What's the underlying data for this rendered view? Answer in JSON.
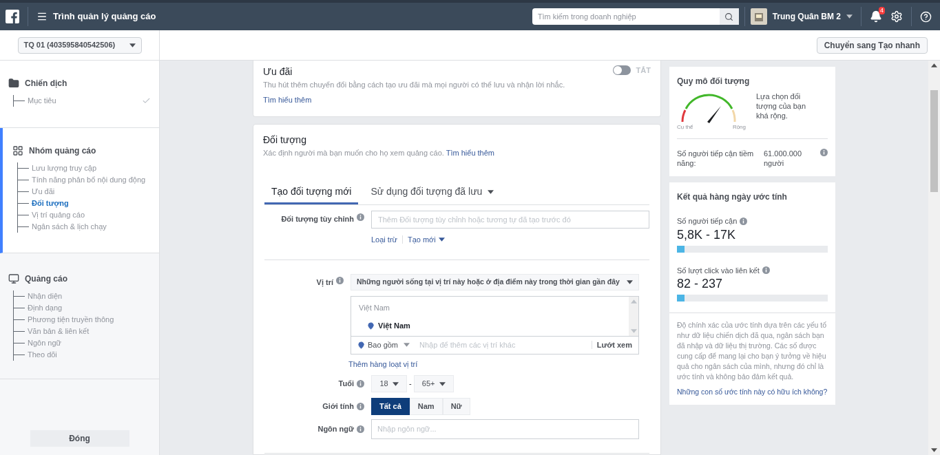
{
  "header": {
    "title": "Trình quản lý quảng cáo",
    "search_placeholder": "Tìm kiếm trong doanh nghiệp",
    "user": "Trung Quân BM 2",
    "notification_count": "4"
  },
  "account": "TQ 01 (403595840542506)",
  "quick_button": "Chuyển sang Tạo nhanh",
  "sidebar": {
    "sections": [
      {
        "title": "Chiến dịch",
        "kind": "campaign",
        "selected": false,
        "items": [
          {
            "label": "Mục tiêu",
            "selected": false,
            "done": true
          }
        ]
      },
      {
        "title": "Nhóm quảng cáo",
        "kind": "adset",
        "selected": true,
        "items": [
          {
            "label": "Lưu lượng truy cập",
            "selected": false,
            "done": false
          },
          {
            "label": "Tính năng phân bổ nội dung động",
            "selected": false,
            "done": false
          },
          {
            "label": "Ưu đãi",
            "selected": false,
            "done": false
          },
          {
            "label": "Đối tượng",
            "selected": true,
            "done": false
          },
          {
            "label": "Vị trí quảng cáo",
            "selected": false,
            "done": false
          },
          {
            "label": "Ngân sách & lịch chạy",
            "selected": false,
            "done": false
          }
        ]
      },
      {
        "title": "Quảng cáo",
        "kind": "ad",
        "selected": false,
        "items": [
          {
            "label": "Nhận diện",
            "selected": false,
            "done": false
          },
          {
            "label": "Định dạng",
            "selected": false,
            "done": false
          },
          {
            "label": "Phương tiện truyền thông",
            "selected": false,
            "done": false
          },
          {
            "label": "Văn bản & liên kết",
            "selected": false,
            "done": false
          },
          {
            "label": "Ngôn ngữ",
            "selected": false,
            "done": false
          },
          {
            "label": "Theo dõi",
            "selected": false,
            "done": false
          }
        ]
      }
    ],
    "close_button": "Đóng"
  },
  "offer": {
    "title": "Ưu đãi",
    "description": "Thu hút thêm chuyển đổi bằng cách tạo ưu đãi mà mọi người có thể lưu và nhận lời nhắc.",
    "link": "Tìm hiểu thêm",
    "toggle": {
      "on": false,
      "label": "TẮT"
    }
  },
  "audience": {
    "title": "Đối tượng",
    "description": "Xác định người mà bạn muốn cho họ xem quảng cáo.",
    "link": "Tìm hiểu thêm",
    "tabs": [
      {
        "label": "Tạo đối tượng mới",
        "selected": true,
        "dropdown": false
      },
      {
        "label": "Sử dụng đối tượng đã lưu",
        "selected": false,
        "dropdown": true
      }
    ],
    "custom_audience": {
      "label": "Đối tượng tùy chỉnh",
      "placeholder": "Thêm Đối tượng tùy chỉnh hoặc tương tự đã tạo trước đó",
      "links": [
        {
          "label": "Loại trừ",
          "dropdown": false
        },
        {
          "label": "Tạo mới",
          "dropdown": true
        }
      ]
    },
    "location": {
      "label": "Vị trí",
      "dropdown": "Những người sống tại vị trí này hoặc ở địa điểm này trong thời gian gần đây",
      "group_label": "Việt Nam",
      "items": [
        "Việt Nam"
      ],
      "include": "Bao gồm",
      "placeholder": "Nhập để thêm các vị trí khác",
      "browse": "Lướt xem",
      "bulk_link": "Thêm hàng loạt vị trí"
    },
    "age": {
      "label": "Tuổi",
      "min": "18",
      "separator": "-",
      "max": "65+"
    },
    "gender": {
      "label": "Giới tính",
      "options": [
        {
          "label": "Tất cả",
          "selected": true
        },
        {
          "label": "Nam",
          "selected": false
        },
        {
          "label": "Nữ",
          "selected": false
        }
      ]
    },
    "language": {
      "label": "Ngôn ngữ",
      "placeholder": "Nhập ngôn ngữ..."
    }
  },
  "audience_size": {
    "title": "Quy mô đối tượng",
    "gauge_min": "Cụ thể",
    "gauge_max": "Rộng",
    "description": "Lựa chọn đối tượng của bạn khá rộng.",
    "reach_label": "Số người tiếp cận tiềm năng:",
    "reach_value": "61.000.000 người"
  },
  "estimates": {
    "title": "Kết quả hàng ngày ước tính",
    "metrics": [
      {
        "label": "Số người tiếp cận",
        "value": "5,8K - 17K",
        "level": 0.05
      },
      {
        "label": "Số lượt click vào liên kết",
        "value": "82 - 237",
        "level": 0.05
      }
    ],
    "disclaimer": "Độ chính xác của ước tính dựa trên các yếu tố như dữ liệu chiến dịch đã qua, ngân sách bạn đã nhập và dữ liệu thị trường. Các số được cung cấp để mang lại cho bạn ý tưởng về hiệu quả cho ngân sách của mình, nhưng đó chỉ là ước tính và không bảo đảm kết quả.",
    "feedback_link": "Những con số ước tính này có hữu ích không?"
  }
}
